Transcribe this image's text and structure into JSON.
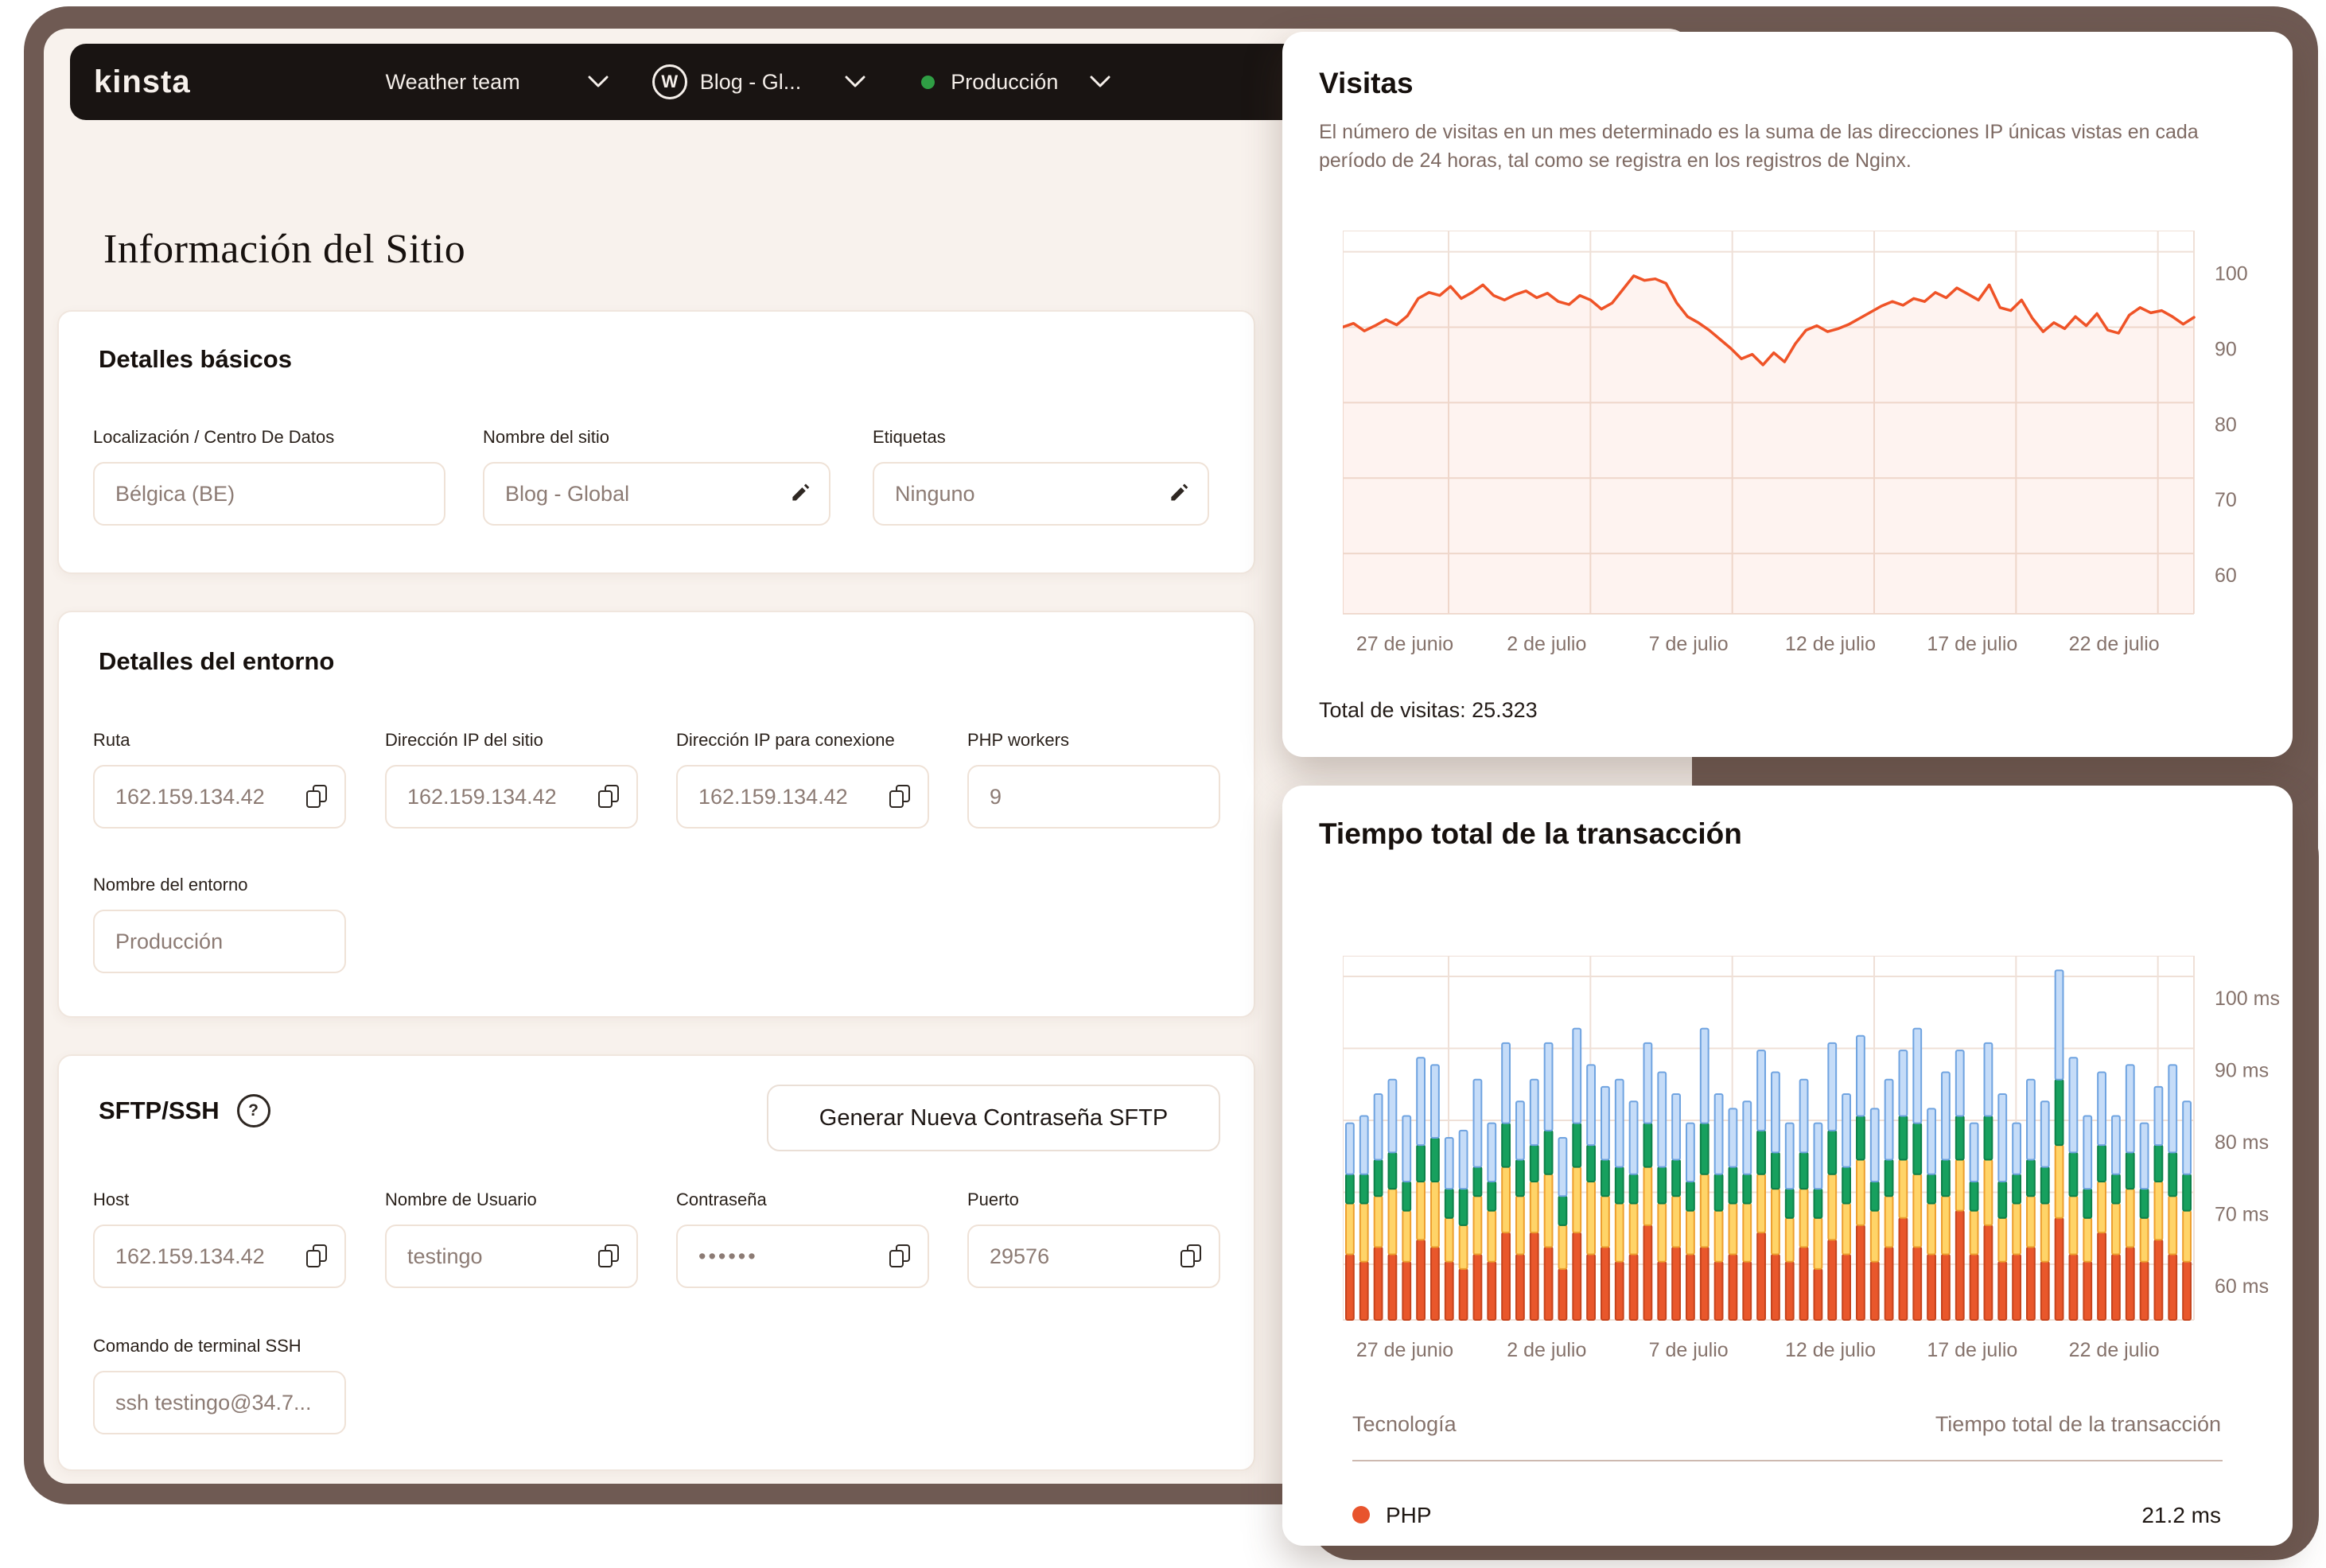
{
  "colors": {
    "backdrop_brown": "#6F5A53",
    "window_cream": "#F8F2ED",
    "nav_dark": "#191412",
    "accent_orange": "#EF5327",
    "env_green_dot": "#2F9E44",
    "grid_line": "#EFE0D7",
    "axis_text": "#85726B"
  },
  "nav": {
    "brand": "kinsta",
    "team": "Weather team",
    "site": "Blog - Gl...",
    "wp_icon_letter": "W",
    "environment": "Producción"
  },
  "page": {
    "title": "Información del Sitio"
  },
  "basic_details": {
    "title": "Detalles básicos",
    "fields": [
      {
        "label": "Localización / Centro De Datos",
        "value": "Bélgica (BE)",
        "icon": "none"
      },
      {
        "label": "Nombre del sitio",
        "value": "Blog - Global",
        "icon": "pencil-icon"
      },
      {
        "label": "Etiquetas",
        "value": "Ninguno",
        "icon": "pencil-icon"
      }
    ]
  },
  "environment_details": {
    "title": "Detalles del entorno",
    "fields": [
      {
        "label": "Ruta",
        "value": "162.159.134.42",
        "icon": "copy-icon"
      },
      {
        "label": "Dirección IP del sitio",
        "value": "162.159.134.42",
        "icon": "copy-icon"
      },
      {
        "label": "Dirección IP para conexione",
        "value": "162.159.134.42",
        "icon": "copy-icon"
      },
      {
        "label": "PHP workers",
        "value": "9",
        "icon": "none"
      },
      {
        "label": "Nombre del entorno",
        "value": "Producción",
        "icon": "none"
      }
    ]
  },
  "sftp": {
    "title": "SFTP/SSH",
    "help_icon": "?",
    "button": "Generar Nueva Contraseña SFTP",
    "fields": [
      {
        "label": "Host",
        "value": "162.159.134.42",
        "icon": "copy-icon"
      },
      {
        "label": "Nombre de Usuario",
        "value": "testingo",
        "icon": "copy-icon"
      },
      {
        "label": "Contraseña",
        "value": "••••••",
        "icon": "copy-icon"
      },
      {
        "label": "Puerto",
        "value": "29576",
        "icon": "copy-icon"
      },
      {
        "label": "Comando de terminal SSH",
        "value": "ssh testingo@34.7...",
        "icon": "none"
      }
    ]
  },
  "visits_card": {
    "title": "Visitas",
    "description": "El número de visitas en un mes determinado es la suma de las direcciones IP únicas vistas en cada período de 24 horas, tal como se registra en los registros de Nginx.",
    "total": "Total de visitas: 25.323"
  },
  "transaction_card": {
    "title": "Tiempo total de la transacción",
    "table": {
      "col_tech": "Tecnología",
      "col_time": "Tiempo total de la transacción",
      "rows": [
        {
          "tech": "PHP",
          "value": "21.2 ms",
          "dot_color": "#E8542D"
        }
      ]
    }
  },
  "chart_data": [
    {
      "type": "line",
      "title": "Visitas",
      "line_color": "#EF5327",
      "fill_color": "rgba(239,83,39,0.07)",
      "x_ticks": [
        "27 de junio",
        "2 de julio",
        "7 de julio",
        "12 de julio",
        "17 de julio",
        "22 de julio"
      ],
      "y_ticks": [
        100,
        90,
        80,
        70,
        60
      ],
      "y_range": [
        52,
        102.8
      ],
      "grid": true,
      "legend": "none",
      "total_visits": "25.323",
      "values": [
        90,
        90.5,
        89.5,
        90.2,
        91,
        90.3,
        91.5,
        93.8,
        94.6,
        94.2,
        95.4,
        93.8,
        94.6,
        95.6,
        94.2,
        93.6,
        94.3,
        94.8,
        93.9,
        94.5,
        93.4,
        93,
        94.2,
        93.6,
        92.4,
        93.2,
        95,
        96.8,
        96.2,
        96.4,
        95.8,
        93.2,
        91.4,
        90.6,
        89.6,
        88.4,
        87.2,
        85.8,
        86.4,
        85,
        86.6,
        85.4,
        87.8,
        89.6,
        90.2,
        89.4,
        89.8,
        90.4,
        91.2,
        92,
        92.8,
        93.4,
        92.9,
        93.8,
        93.4,
        94.6,
        93.9,
        95.2,
        94.4,
        93.6,
        95.6,
        92.6,
        92.2,
        93.6,
        91.2,
        89.4,
        90.6,
        89.8,
        91.4,
        90.2,
        91.8,
        89.6,
        89.2,
        91.6,
        92.6,
        91.9,
        92.2,
        91.4,
        90.4,
        91.3
      ]
    },
    {
      "type": "stacked-bar",
      "title": "Tiempo total de la transacción",
      "unit": "ms",
      "x_ticks": [
        "27 de junio",
        "2 de julio",
        "7 de julio",
        "12 de julio",
        "17 de julio",
        "22 de julio"
      ],
      "y_ticks": [
        "100 ms",
        "90 ms",
        "80 ms",
        "70 ms",
        "60 ms"
      ],
      "grid": true,
      "php_total": "21.2 ms",
      "segment_colors": [
        {
          "fill": "#E9572B",
          "stroke": "#C6431C"
        },
        {
          "fill": "#FFD468",
          "stroke": "#ED9F2E"
        },
        {
          "fill": "#17A05E",
          "stroke": "#0C8049"
        },
        {
          "fill": "#C5DCF8",
          "stroke": "#6FA3E0"
        }
      ],
      "bars": [
        [
          9,
          7,
          4,
          7
        ],
        [
          8,
          8,
          4,
          8
        ],
        [
          10,
          7,
          5,
          9
        ],
        [
          9,
          9,
          5,
          10
        ],
        [
          8,
          7,
          4,
          9
        ],
        [
          11,
          8,
          5,
          12
        ],
        [
          10,
          9,
          6,
          10
        ],
        [
          8,
          6,
          4,
          7
        ],
        [
          7,
          6,
          5,
          8
        ],
        [
          9,
          8,
          4,
          12
        ],
        [
          8,
          7,
          4,
          8
        ],
        [
          12,
          9,
          6,
          11
        ],
        [
          9,
          8,
          5,
          8
        ],
        [
          12,
          7,
          5,
          9
        ],
        [
          10,
          10,
          6,
          12
        ],
        [
          7,
          6,
          4,
          8
        ],
        [
          12,
          9,
          6,
          13
        ],
        [
          9,
          10,
          5,
          11
        ],
        [
          10,
          7,
          5,
          10
        ],
        [
          8,
          8,
          5,
          12
        ],
        [
          9,
          7,
          4,
          10
        ],
        [
          13,
          8,
          6,
          11
        ],
        [
          8,
          8,
          5,
          13
        ],
        [
          10,
          7,
          5,
          9
        ],
        [
          9,
          6,
          4,
          8
        ],
        [
          10,
          10,
          7,
          13
        ],
        [
          8,
          7,
          5,
          11
        ],
        [
          9,
          7,
          5,
          8
        ],
        [
          8,
          8,
          4,
          10
        ],
        [
          12,
          8,
          6,
          11
        ],
        [
          9,
          9,
          5,
          11
        ],
        [
          8,
          6,
          4,
          9
        ],
        [
          10,
          8,
          5,
          10
        ],
        [
          7,
          7,
          4,
          9
        ],
        [
          11,
          9,
          6,
          12
        ],
        [
          9,
          7,
          5,
          10
        ],
        [
          13,
          9,
          6,
          11
        ],
        [
          8,
          7,
          4,
          10
        ],
        [
          10,
          7,
          5,
          11
        ],
        [
          14,
          8,
          6,
          9
        ],
        [
          10,
          10,
          7,
          13
        ],
        [
          9,
          7,
          4,
          9
        ],
        [
          9,
          8,
          5,
          12
        ],
        [
          15,
          7,
          6,
          9
        ],
        [
          9,
          6,
          4,
          8
        ],
        [
          13,
          9,
          6,
          10
        ],
        [
          8,
          6,
          5,
          12
        ],
        [
          9,
          7,
          4,
          7
        ],
        [
          10,
          7,
          5,
          11
        ],
        [
          8,
          8,
          5,
          9
        ],
        [
          14,
          10,
          9,
          15
        ],
        [
          9,
          8,
          6,
          13
        ],
        [
          8,
          6,
          4,
          10
        ],
        [
          12,
          7,
          5,
          10
        ],
        [
          9,
          7,
          4,
          8
        ],
        [
          10,
          8,
          5,
          12
        ],
        [
          8,
          6,
          4,
          9
        ],
        [
          11,
          8,
          5,
          8
        ],
        [
          9,
          8,
          6,
          12
        ],
        [
          8,
          7,
          5,
          10
        ]
      ]
    }
  ]
}
